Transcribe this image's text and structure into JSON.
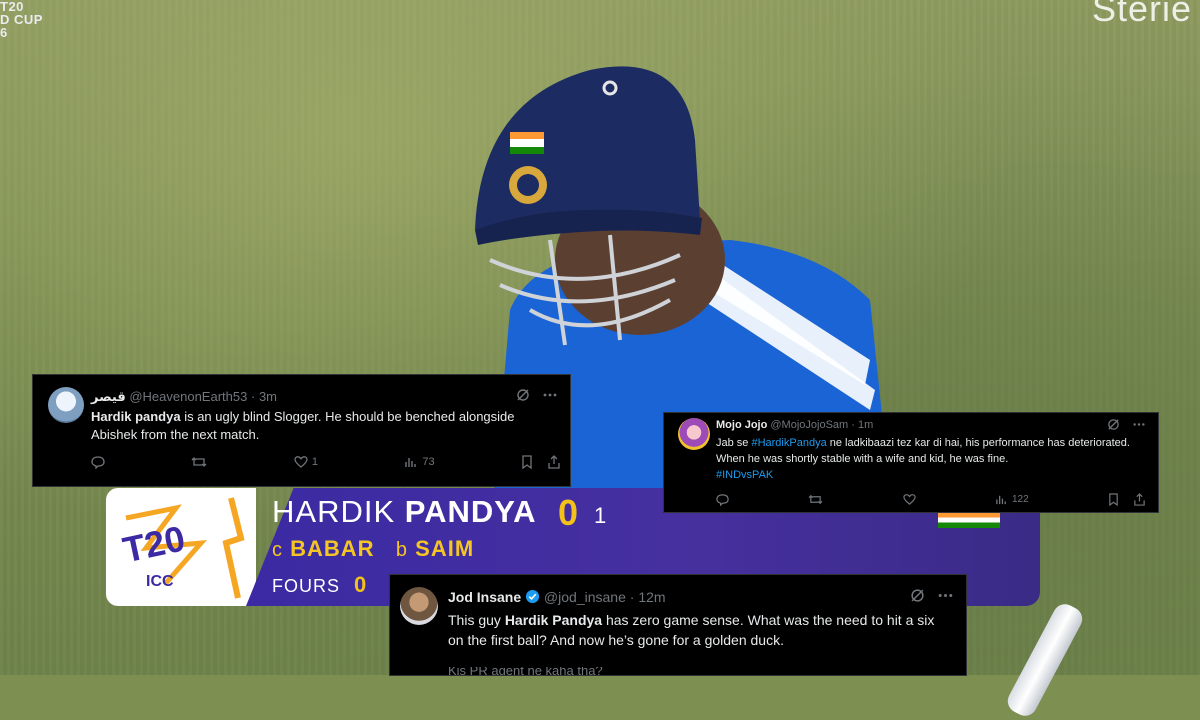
{
  "background": {
    "event_logo_lines": [
      "T20",
      "D CUP",
      "6"
    ],
    "corner_brand": "Sterie"
  },
  "scoreboard": {
    "first_name": "HARDIK",
    "last_name": "PANDYA",
    "runs": "0",
    "balls": "1",
    "caught_prefix": "c",
    "fielder": "BABAR",
    "bowled_prefix": "b",
    "bowler": "SAIM",
    "fours_label": "FOURS",
    "fours_value": "0",
    "logo_text": "T20",
    "logo_sub": "ICC",
    "colors": {
      "panel": "#3b2aa3",
      "accent": "#f3c218"
    }
  },
  "tweets": [
    {
      "display_name": "قیصر",
      "handle": "@HeavenonEarth53",
      "time": "3m",
      "text_bold": "Hardik pandya",
      "text_rest": " is an ugly blind Slogger. He should be benched alongside Abishek from the next match.",
      "replies": "",
      "retweets": "",
      "likes": "1",
      "views": "73"
    },
    {
      "display_name": "Mojo Jojo",
      "handle": "@MojoJojoSam",
      "time": "1m",
      "text_before": "Jab se ",
      "hashtag1": "#HardikPandya",
      "text_after": " ne ladkibaazi tez kar di hai, his performance has deteriorated. When he was shortly stable with a wife and kid, he was fine.",
      "hashtag2": "#INDvsPAK",
      "replies": "",
      "retweets": "",
      "likes": "",
      "views": "122"
    },
    {
      "display_name": "Jod Insane",
      "handle": "@jod_insane",
      "time": "12m",
      "text_before": "This guy ",
      "text_bold": "Hardik Pandya",
      "text_after": " has zero game sense. What was the need to hit a six on the first ball? And now he’s gone for a golden duck.",
      "cut_text": "Kis PR agent ne kaha tha?"
    }
  ],
  "sep": "·",
  "icon_names": [
    "grok-icon",
    "more-icon",
    "reply-icon",
    "retweet-icon",
    "like-icon",
    "views-icon",
    "bookmark-icon",
    "share-icon",
    "verified-badge-icon"
  ]
}
